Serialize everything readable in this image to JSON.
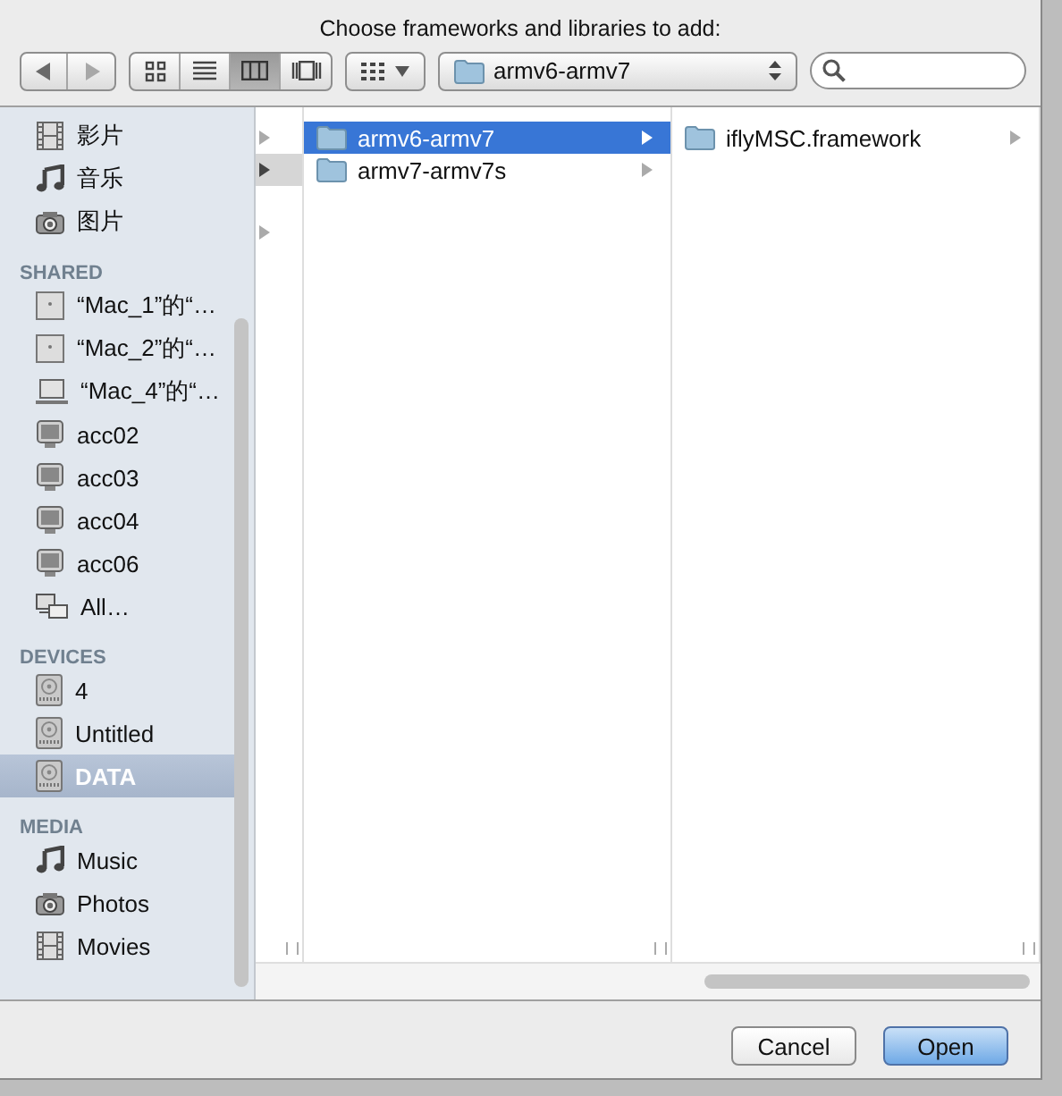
{
  "window": {
    "title": "Choose frameworks and libraries to add:"
  },
  "toolbar": {
    "views": [
      {
        "kind": "icons",
        "selected": false
      },
      {
        "kind": "list",
        "selected": false
      },
      {
        "kind": "columns",
        "selected": true
      },
      {
        "kind": "coverflow",
        "selected": false
      }
    ],
    "path": "armv6-armv7"
  },
  "sidebar": {
    "sections": [
      {
        "items": [
          {
            "kind": "film",
            "label": "影片",
            "selected": false
          },
          {
            "kind": "music",
            "label": "音乐",
            "selected": false
          },
          {
            "kind": "camera",
            "label": "图片",
            "selected": false
          }
        ]
      },
      {
        "header": "SHARED",
        "items": [
          {
            "kind": "server",
            "label": "“Mac_1”的“…",
            "selected": false
          },
          {
            "kind": "server",
            "label": "“Mac_2”的“…",
            "selected": false
          },
          {
            "kind": "laptop",
            "label": "“Mac_4”的“…",
            "selected": false
          },
          {
            "kind": "monitor",
            "label": "acc02",
            "selected": false
          },
          {
            "kind": "monitor",
            "label": "acc03",
            "selected": false
          },
          {
            "kind": "monitor",
            "label": "acc04",
            "selected": false
          },
          {
            "kind": "monitor",
            "label": "acc06",
            "selected": false
          },
          {
            "kind": "network",
            "label": "All…",
            "selected": false
          }
        ]
      },
      {
        "header": "DEVICES",
        "items": [
          {
            "kind": "disk",
            "label": "4",
            "selected": false
          },
          {
            "kind": "disk",
            "label": "Untitled",
            "selected": false
          },
          {
            "kind": "disk",
            "label": "DATA",
            "selected": true
          }
        ]
      },
      {
        "header": "MEDIA",
        "items": [
          {
            "kind": "music",
            "label": "Music",
            "selected": false
          },
          {
            "kind": "camera",
            "label": "Photos",
            "selected": false
          },
          {
            "kind": "film",
            "label": "Movies",
            "selected": false
          }
        ]
      }
    ]
  },
  "browser": {
    "parent_rows": [
      {
        "selected": false
      },
      {
        "selected": true
      },
      {
        "selected": false
      }
    ],
    "columns": [
      {
        "items": [
          {
            "label": "armv6-armv7",
            "selected": true
          },
          {
            "label": "armv7-armv7s",
            "selected": false
          }
        ]
      },
      {
        "items": [
          {
            "label": "iflyMSC.framework",
            "selected": false
          }
        ]
      }
    ]
  },
  "buttons": [
    {
      "label": "Cancel",
      "kind": "normal"
    },
    {
      "label": "Open",
      "kind": "default"
    }
  ]
}
